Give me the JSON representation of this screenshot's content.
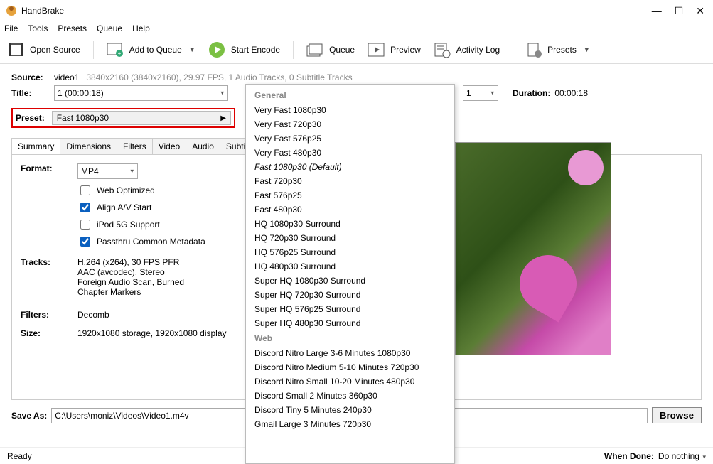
{
  "window": {
    "title": "HandBrake"
  },
  "menu": [
    "File",
    "Tools",
    "Presets",
    "Queue",
    "Help"
  ],
  "toolbar": {
    "open_source": "Open Source",
    "add_to_queue": "Add to Queue",
    "start_encode": "Start Encode",
    "queue": "Queue",
    "preview": "Preview",
    "activity_log": "Activity Log",
    "presets": "Presets"
  },
  "source": {
    "label": "Source:",
    "name": "video1",
    "info": "3840x2160 (3840x2160), 29.97 FPS, 1 Audio Tracks, 0 Subtitle Tracks"
  },
  "title": {
    "label": "Title:",
    "value": "1  (00:00:18)"
  },
  "range_end": "1",
  "duration": {
    "label": "Duration:",
    "value": "00:00:18"
  },
  "preset": {
    "label": "Preset:",
    "value": "Fast 1080p30"
  },
  "tabs": [
    "Summary",
    "Dimensions",
    "Filters",
    "Video",
    "Audio",
    "Subtitle"
  ],
  "summary": {
    "format_label": "Format:",
    "format_value": "MP4",
    "web_optimized": "Web Optimized",
    "align_av": "Align A/V Start",
    "ipod": "iPod 5G Support",
    "passthru": "Passthru Common Metadata",
    "tracks_label": "Tracks:",
    "tracks": [
      "H.264 (x264), 30 FPS PFR",
      "AAC (avcodec), Stereo",
      "Foreign Audio Scan, Burned",
      "Chapter Markers"
    ],
    "filters_label": "Filters:",
    "filters_value": "Decomb",
    "size_label": "Size:",
    "size_value": "1920x1080 storage, 1920x1080 display"
  },
  "saveas": {
    "label": "Save As:",
    "path": "C:\\Users\\moniz\\Videos\\Video1.m4v",
    "browse": "Browse"
  },
  "status": {
    "ready": "Ready",
    "when_done_label": "When Done:",
    "when_done_value": "Do nothing"
  },
  "popup": {
    "heading_general": "General",
    "general": [
      {
        "label": "Very Fast 1080p30",
        "default": false
      },
      {
        "label": "Very Fast 720p30",
        "default": false
      },
      {
        "label": "Very Fast 576p25",
        "default": false
      },
      {
        "label": "Very Fast 480p30",
        "default": false
      },
      {
        "label": "Fast 1080p30 (Default)",
        "default": true
      },
      {
        "label": "Fast 720p30",
        "default": false
      },
      {
        "label": "Fast 576p25",
        "default": false
      },
      {
        "label": "Fast 480p30",
        "default": false
      },
      {
        "label": "HQ 1080p30 Surround",
        "default": false
      },
      {
        "label": "HQ 720p30 Surround",
        "default": false
      },
      {
        "label": "HQ 576p25 Surround",
        "default": false
      },
      {
        "label": "HQ 480p30 Surround",
        "default": false
      },
      {
        "label": "Super HQ 1080p30 Surround",
        "default": false
      },
      {
        "label": "Super HQ 720p30 Surround",
        "default": false
      },
      {
        "label": "Super HQ 576p25 Surround",
        "default": false
      },
      {
        "label": "Super HQ 480p30 Surround",
        "default": false
      }
    ],
    "heading_web": "Web",
    "web": [
      "Discord Nitro Large 3-6 Minutes 1080p30",
      "Discord Nitro Medium 5-10 Minutes 720p30",
      "Discord Nitro Small 10-20 Minutes 480p30",
      "Discord Small 2 Minutes 360p30",
      "Discord Tiny 5 Minutes 240p30",
      "Gmail Large 3 Minutes 720p30"
    ]
  }
}
